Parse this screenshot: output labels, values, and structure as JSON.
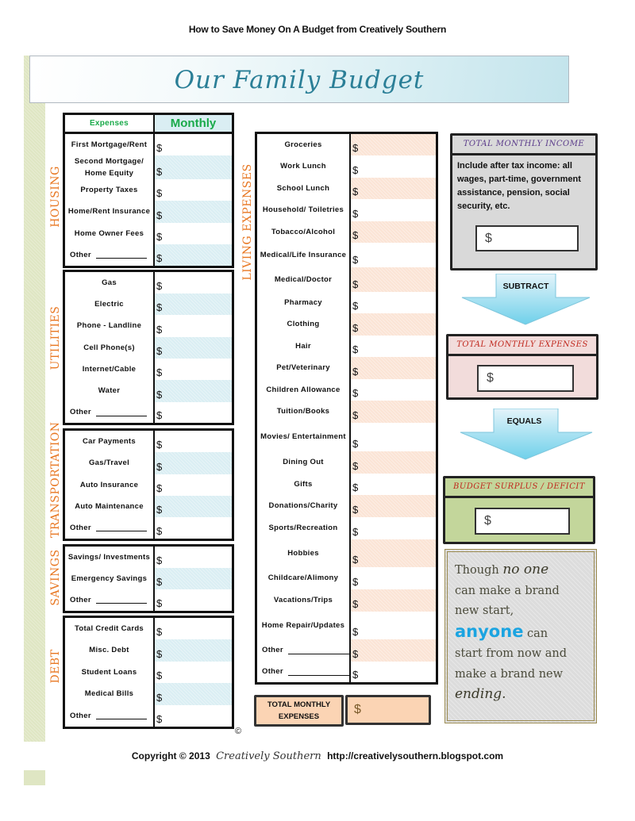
{
  "page_title": "How to Save Money On A Budget from Creatively Southern",
  "banner_title": "Our Family Budget",
  "currency_symbol": "$",
  "left_header": {
    "expenses_label": "Expenses",
    "monthly_label": "Monthly"
  },
  "sections": {
    "housing": {
      "label": "HOUSING",
      "items": [
        "First Mortgage/Rent",
        "Second Mortgage/ Home Equity",
        "Property Taxes",
        "Home/Rent Insurance",
        "Home Owner Fees",
        "Other"
      ]
    },
    "utilities": {
      "label": "UTILITIES",
      "items": [
        "Gas",
        "Electric",
        "Phone - Landline",
        "Cell Phone(s)",
        "Internet/Cable",
        "Water",
        "Other"
      ]
    },
    "transportation": {
      "label": "TRANSPORTATION",
      "items": [
        "Car Payments",
        "Gas/Travel",
        "Auto Insurance",
        "Auto Maintenance",
        "Other"
      ]
    },
    "savings": {
      "label": "SAVINGS",
      "items": [
        "Savings/ Investments",
        "Emergency Savings",
        "Other"
      ]
    },
    "debt": {
      "label": "DEBT",
      "items": [
        "Total Credit Cards",
        "Misc. Debt",
        "Student Loans",
        "Medical Bills",
        "Other"
      ]
    },
    "living": {
      "label": "LIVING EXPENSES",
      "items": [
        "Groceries",
        "Work Lunch",
        "School Lunch",
        "Household/ Toiletries",
        "Tobacco/Alcohol",
        "Medical/Life Insurance",
        "Medical/Doctor",
        "Pharmacy",
        "Clothing",
        "Hair",
        "Pet/Veterinary",
        "Children Allowance",
        "Tuition/Books",
        "Movies/ Entertainment",
        "Dining Out",
        "Gifts",
        "Donations/Charity",
        "Sports/Recreation",
        "Hobbies",
        "Childcare/Alimony",
        "Vacations/Trips",
        "Home Repair/Updates",
        "Other",
        "Other"
      ]
    }
  },
  "total_monthly_expenses_label": "TOTAL MONTHLY EXPENSES",
  "summary": {
    "income": {
      "title": "TOTAL MONTHLY INCOME",
      "description": "Include after tax income: all wages, part-time, government assistance, pension, social security, etc.",
      "color": "#d9d9d9"
    },
    "subtract_label": "SUBTRACT",
    "expenses": {
      "title": "TOTAL MONTHLY EXPENSES",
      "color": "#f2dcdb"
    },
    "equals_label": "EQUALS",
    "result": {
      "title": "BUDGET SURPLUS / DEFICIT",
      "color": "#c3d69b"
    }
  },
  "quote": {
    "line1_a": "Though ",
    "line1_b": "no one",
    "line2": "can make a brand",
    "line3": "new start,",
    "line4_a": "anyone",
    "line4_b": " can",
    "line5": "start from now and",
    "line6": "make a brand new",
    "line7": "ending."
  },
  "copyright_mark": "©",
  "footer": {
    "prefix": "Copyright © 2013",
    "brand": "Creatively Southern",
    "url": "http://creativelysouthern.blogspot.com"
  }
}
